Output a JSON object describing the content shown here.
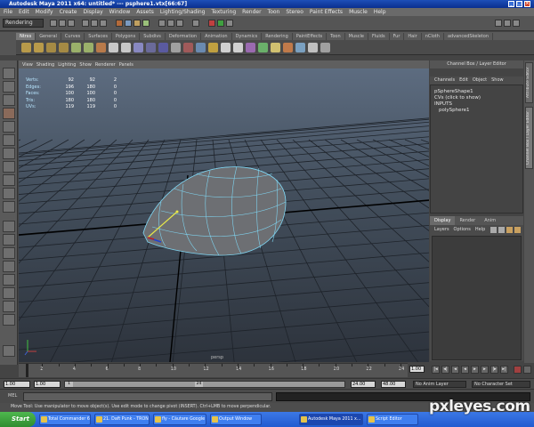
{
  "window": {
    "title": "Autodesk Maya 2011 x64: untitled*   ---   psphere1.vtx[66:67]"
  },
  "menubar": [
    "File",
    "Edit",
    "Modify",
    "Create",
    "Display",
    "Window",
    "Assets",
    "Lighting/Shading",
    "Texturing",
    "Render",
    "Toon",
    "Stereo",
    "Paint Effects",
    "Muscle",
    "Help"
  ],
  "statusline": {
    "mode": "Rendering"
  },
  "shelf": {
    "tabs": [
      "Ntrxs",
      "General",
      "Curves",
      "Surfaces",
      "Polygons",
      "Subdivs",
      "Deformation",
      "Animation",
      "Dynamics",
      "Rendering",
      "PaintEffects",
      "Toon",
      "Muscle",
      "Fluids",
      "Fur",
      "Hair",
      "nCloth",
      "advancedSkeleton"
    ],
    "active_tab": "Ntrxs"
  },
  "viewport": {
    "menu": [
      "View",
      "Shading",
      "Lighting",
      "Show",
      "Renderer",
      "Panels"
    ],
    "hud": [
      {
        "label": "Verts:",
        "a": "92",
        "b": "92",
        "c": "2"
      },
      {
        "label": "Edges:",
        "a": "196",
        "b": "180",
        "c": "0"
      },
      {
        "label": "Faces:",
        "a": "100",
        "b": "100",
        "c": "0"
      },
      {
        "label": "Tris:",
        "a": "180",
        "b": "180",
        "c": "0"
      },
      {
        "label": "UVs:",
        "a": "119",
        "b": "119",
        "c": "0"
      }
    ],
    "camera_label": "persp"
  },
  "channelbox": {
    "header": "Channel Box / Layer Editor",
    "menu": [
      "Channels",
      "Edit",
      "Object",
      "Show"
    ],
    "shape": "pSphereShape1",
    "cvs": "CVs (click to show)",
    "inputs_label": "INPUTS",
    "input_node": "polySphere1"
  },
  "layer_editor": {
    "tabs": [
      "Display",
      "Render",
      "Anim"
    ],
    "active_tab": "Display",
    "menu": [
      "Layers",
      "Options",
      "Help"
    ]
  },
  "side_tabs": [
    "Attribute Editor",
    "Channel Box / Layer Editor"
  ],
  "timeslider": {
    "ticks": [
      "2",
      "4",
      "6",
      "8",
      "10",
      "12",
      "14",
      "16",
      "18",
      "20",
      "22",
      "24"
    ],
    "current_frame": "1.00"
  },
  "range": {
    "start": "1.00",
    "playback_start": "1.00",
    "handle_start": "1",
    "handle_end": "24",
    "playback_end": "24.00",
    "end": "48.00",
    "anim_layer": "No Anim Layer",
    "character_set": "No Character Set"
  },
  "command": {
    "label": "MEL"
  },
  "helpline": "Move Tool: Use manipulator to move object(s). Use edit mode to change pivot (INSERT). Ctrl+LMB to move perpendicular.",
  "taskbar": {
    "start": "Start",
    "buttons": [
      "Total Commander 6.03 - ...",
      "21. Daft Punk - TRON Le...",
      "fly - Căutare Google - Go...",
      "Output Window",
      "Autodesk Maya 2011 x...",
      "Script Editor"
    ],
    "active_index": 4
  },
  "watermark": "pxleyes.com",
  "colors": {
    "wireframe": "#7fd4f0",
    "grid": "#1e232a",
    "selection": "#a82020"
  }
}
